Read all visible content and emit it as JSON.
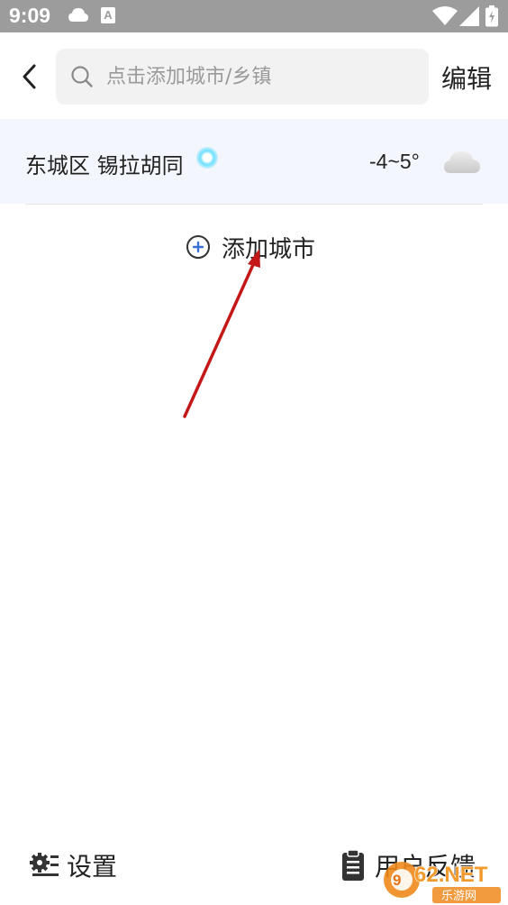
{
  "status_bar": {
    "time": "9:09",
    "notification_badge": "A"
  },
  "header": {
    "search_placeholder": "点击添加城市/乡镇",
    "edit_label": "编辑"
  },
  "cities": [
    {
      "name": "东城区 锡拉胡同",
      "temperature": "-4~5°",
      "weather_icon": "cloud-icon",
      "is_current_location": true
    }
  ],
  "add_city": {
    "label": "添加城市"
  },
  "bottom_bar": {
    "settings_label": "设置",
    "feedback_label": "用户反馈"
  },
  "watermark": {
    "brand": "962.NET",
    "subtitle": "乐游网"
  },
  "colors": {
    "status_bar": "#9c9c9c",
    "city_row_bg": "#f3f6fc",
    "search_bg": "#f2f2f2",
    "location_dot": "#6fe0ff",
    "add_icon_accent": "#3b6fd8",
    "annotation_arrow": "#d01c1c"
  }
}
